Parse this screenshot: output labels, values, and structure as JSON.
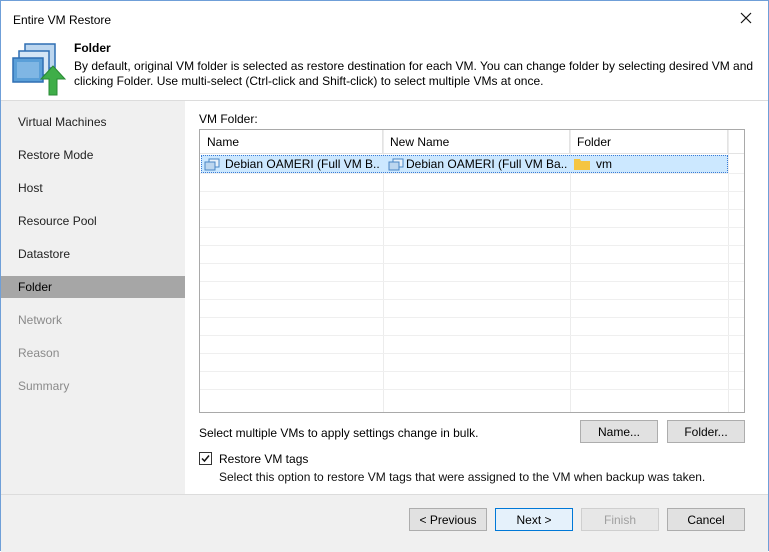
{
  "window": {
    "title": "Entire VM Restore"
  },
  "header": {
    "title": "Folder",
    "description": "By default, original VM folder is selected as restore destination for each VM. You can change folder by selecting desired VM and clicking Folder. Use multi-select (Ctrl-click and Shift-click) to select multiple VMs at once."
  },
  "sidebar": {
    "items": [
      {
        "label": "Virtual Machines",
        "state": "normal"
      },
      {
        "label": "Restore Mode",
        "state": "normal"
      },
      {
        "label": "Host",
        "state": "normal"
      },
      {
        "label": "Resource Pool",
        "state": "normal"
      },
      {
        "label": "Datastore",
        "state": "normal"
      },
      {
        "label": "Folder",
        "state": "active"
      },
      {
        "label": "Network",
        "state": "disabled"
      },
      {
        "label": "Reason",
        "state": "disabled"
      },
      {
        "label": "Summary",
        "state": "disabled"
      }
    ]
  },
  "main": {
    "vm_folder_label": "VM Folder:",
    "columns": [
      "Name",
      "New Name",
      "Folder"
    ],
    "rows": [
      {
        "name": "Debian OAMERI (Full VM B...",
        "new_name": "Debian OAMERI (Full VM Ba...",
        "folder": "vm",
        "selected": true
      }
    ],
    "bulk_text": "Select multiple VMs to apply settings change in bulk.",
    "name_button": "Name...",
    "folder_button": "Folder...",
    "restore_tags": {
      "label": "Restore VM tags",
      "checked": true,
      "description": "Select this option to restore VM tags that were assigned to the VM when backup was taken."
    }
  },
  "footer": {
    "previous": "< Previous",
    "next": "Next >",
    "finish": "Finish",
    "cancel": "Cancel"
  },
  "colors": {
    "accent": "#0078d7",
    "selection": "#cce8ff",
    "sidebar_active": "#a6a6a6",
    "sidebar_bg": "#f0f0f0",
    "folder_icon": "#f5c542",
    "arrow_icon": "#3fae49"
  },
  "icons": {
    "close": "close-icon",
    "wizard": "vm-restore-icon",
    "vm": "vm-icon",
    "folder": "folder-icon",
    "check": "checkmark-icon"
  }
}
